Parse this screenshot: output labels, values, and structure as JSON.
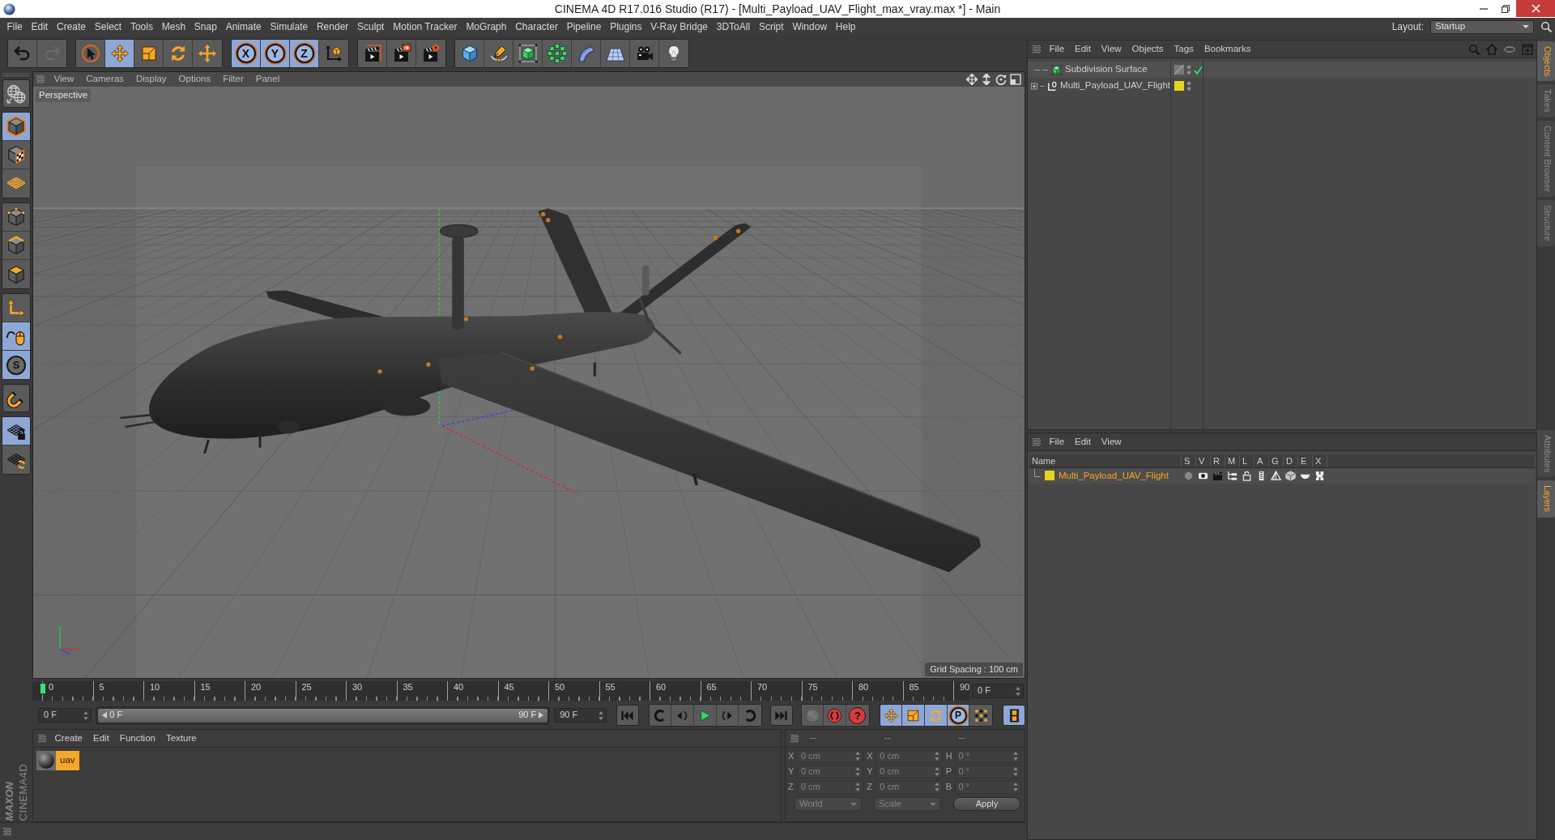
{
  "window": {
    "title": "CINEMA 4D R17.016 Studio (R17) - [Multi_Payload_UAV_Flight_max_vray.max *] - Main"
  },
  "menu_bar": [
    "File",
    "Edit",
    "Create",
    "Select",
    "Tools",
    "Mesh",
    "Snap",
    "Animate",
    "Simulate",
    "Render",
    "Sculpt",
    "Motion Tracker",
    "MoGraph",
    "Character",
    "Pipeline",
    "Plugins",
    "V-Ray Bridge",
    "3DToAll",
    "Script",
    "Window",
    "Help"
  ],
  "layout": {
    "label": "Layout:",
    "value": "Startup"
  },
  "toolbar": [
    [
      {
        "kind": "undo",
        "active": false,
        "disabled": false
      },
      {
        "kind": "redo",
        "active": false,
        "disabled": true
      }
    ],
    [
      {
        "kind": "live-select",
        "active": false
      },
      {
        "kind": "move",
        "active": true
      },
      {
        "kind": "scale",
        "active": false
      },
      {
        "kind": "rotate",
        "active": false
      },
      {
        "kind": "transform",
        "active": false
      }
    ],
    [
      {
        "kind": "axis",
        "label": "X",
        "active": true
      },
      {
        "kind": "axis",
        "label": "Y",
        "active": true
      },
      {
        "kind": "axis",
        "label": "Z",
        "active": true
      },
      {
        "kind": "coordinates",
        "active": false
      }
    ],
    [
      {
        "kind": "render-view",
        "active": false
      },
      {
        "kind": "render-picture",
        "active": false
      },
      {
        "kind": "render-settings",
        "active": false
      }
    ],
    [
      {
        "kind": "cube",
        "active": false
      },
      {
        "kind": "pen",
        "active": false
      },
      {
        "kind": "subdivision",
        "active": false
      },
      {
        "kind": "cloner",
        "active": false
      },
      {
        "kind": "bend",
        "active": false
      },
      {
        "kind": "floor",
        "active": false
      },
      {
        "kind": "camera",
        "active": false
      },
      {
        "kind": "light",
        "active": false
      }
    ]
  ],
  "left_toolbar": [
    [
      {
        "kind": "make-editable",
        "active": false
      }
    ],
    [
      {
        "kind": "model",
        "active": true
      },
      {
        "kind": "texture",
        "active": false
      },
      {
        "kind": "workplane",
        "active": false
      }
    ],
    [
      {
        "kind": "points",
        "active": false
      },
      {
        "kind": "edges",
        "active": false
      },
      {
        "kind": "polygons",
        "active": false
      }
    ],
    [
      {
        "kind": "axis-mode",
        "active": false
      },
      {
        "kind": "tweak",
        "active": true
      },
      {
        "kind": "snap",
        "label": "S",
        "active": true
      }
    ],
    [
      {
        "kind": "magnet",
        "active": false
      }
    ],
    [
      {
        "kind": "grid-lock",
        "active": true
      },
      {
        "kind": "grid-rotate",
        "active": false
      }
    ]
  ],
  "viewport": {
    "menu": [
      "View",
      "Cameras",
      "Display",
      "Options",
      "Filter",
      "Panel"
    ],
    "camera": "Perspective",
    "grid_spacing": "Grid Spacing : 100 cm"
  },
  "timeline": {
    "ticks": [
      "0",
      "5",
      "10",
      "15",
      "20",
      "25",
      "30",
      "35",
      "40",
      "45",
      "50",
      "55",
      "60",
      "65",
      "70",
      "75",
      "80",
      "85",
      "90"
    ],
    "playhead": {
      "level": 0
    },
    "current_frame": "0 F"
  },
  "playback": {
    "start": "0 F",
    "range": {
      "start": "0 F",
      "end": "90 F",
      "level": 1
    },
    "end": "90 F",
    "buttons": [
      [
        {
          "kind": "go-start",
          "active": false
        }
      ],
      [
        {
          "kind": "prev-key",
          "active": false
        },
        {
          "kind": "step-back",
          "active": false
        },
        {
          "kind": "play",
          "active": false
        },
        {
          "kind": "step-fwd",
          "active": false
        },
        {
          "kind": "next-key",
          "active": false
        }
      ],
      [
        {
          "kind": "go-end",
          "active": false
        }
      ],
      [
        {
          "kind": "record",
          "active": false,
          "disabled": true
        },
        {
          "kind": "autokey",
          "active": false,
          "disabled": false
        },
        {
          "kind": "key-help",
          "label": "?",
          "active": false,
          "disabled": false
        }
      ],
      [
        {
          "kind": "key-pos",
          "active": true
        },
        {
          "kind": "key-scale",
          "active": true
        },
        {
          "kind": "key-rot",
          "active": true
        },
        {
          "kind": "key-param",
          "label": "P",
          "active": true
        },
        {
          "kind": "key-pla",
          "active": false
        }
      ],
      [
        {
          "kind": "timeline",
          "active": true
        }
      ]
    ]
  },
  "material_manager": {
    "menu": [
      "Create",
      "Edit",
      "Function",
      "Texture"
    ],
    "materials": [
      {
        "name": "uav",
        "selected": true
      }
    ]
  },
  "coordinates": {
    "disabled": true,
    "headers": [
      "--",
      "--",
      "--"
    ],
    "rows": [
      [
        {
          "axis": "X",
          "value": "0 cm"
        },
        {
          "axis": "X",
          "value": "0 cm"
        },
        {
          "axis": "H",
          "value": "0 °"
        }
      ],
      [
        {
          "axis": "Y",
          "value": "0 cm"
        },
        {
          "axis": "Y",
          "value": "0 cm"
        },
        {
          "axis": "P",
          "value": "0 °"
        }
      ],
      [
        {
          "axis": "Z",
          "value": "0 cm"
        },
        {
          "axis": "Z",
          "value": "0 cm"
        },
        {
          "axis": "B",
          "value": "0 °"
        }
      ]
    ],
    "dropdowns": [
      "World",
      "Scale"
    ],
    "apply": "Apply"
  },
  "object_manager": {
    "menu": [
      "File",
      "Edit",
      "View",
      "Objects",
      "Tags",
      "Bookmarks"
    ],
    "objects": [
      {
        "kind": "subdivision",
        "name": "Subdivision Surface",
        "enabled": true
      },
      {
        "kind": "null",
        "name": "Multi_Payload_UAV_Flight",
        "expanded": false,
        "color": "#e2d41f"
      }
    ]
  },
  "layer_manager": {
    "menu": [
      "File",
      "Edit",
      "View"
    ],
    "columns": [
      "Name",
      "S",
      "V",
      "R",
      "M",
      "L",
      "A",
      "G",
      "D",
      "E",
      "X"
    ],
    "layers": [
      {
        "name": "Multi_Payload_UAV_Flight",
        "color": "#e2d41f",
        "selected": true
      }
    ]
  },
  "side_tabs": {
    "upper": [
      {
        "label": "Objects",
        "selected": true
      },
      {
        "label": "Takes",
        "selected": false
      },
      {
        "label": "Content Browser",
        "selected": false
      },
      {
        "label": "Structure",
        "selected": false
      }
    ],
    "lower": [
      {
        "label": "Attributes",
        "selected": false
      },
      {
        "label": "Layers",
        "selected": true
      }
    ]
  },
  "logo": {
    "brand": "MAXON",
    "product": "CINEMA4D"
  }
}
